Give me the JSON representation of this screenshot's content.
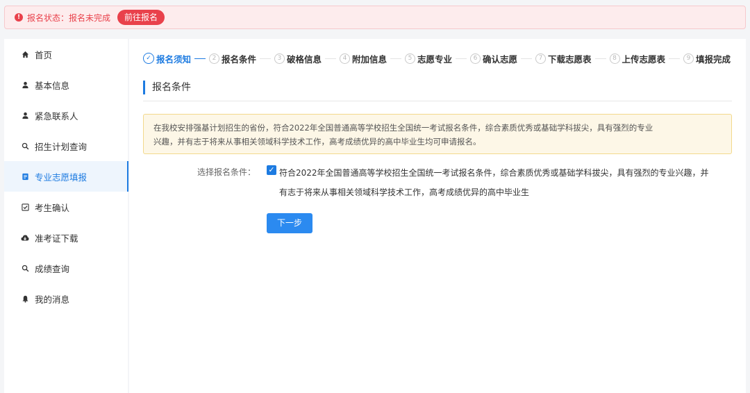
{
  "alert": {
    "status_text": "报名状态：报名未完成",
    "action_label": "前往报名"
  },
  "sidebar": {
    "items": [
      {
        "label": "首页",
        "icon": "home-icon"
      },
      {
        "label": "基本信息",
        "icon": "user-icon"
      },
      {
        "label": "紧急联系人",
        "icon": "user-icon"
      },
      {
        "label": "招生计划查询",
        "icon": "search-icon"
      },
      {
        "label": "专业志愿填报",
        "icon": "document-icon",
        "active": true
      },
      {
        "label": "考生确认",
        "icon": "checkbox-icon"
      },
      {
        "label": "准考证下载",
        "icon": "cloud-download-icon"
      },
      {
        "label": "成绩查询",
        "icon": "search-icon"
      },
      {
        "label": "我的消息",
        "icon": "bell-icon"
      }
    ]
  },
  "steps": [
    {
      "num": "✓",
      "label": "报名须知",
      "done": true
    },
    {
      "num": "2",
      "label": "报名条件"
    },
    {
      "num": "3",
      "label": "破格信息"
    },
    {
      "num": "4",
      "label": "附加信息"
    },
    {
      "num": "5",
      "label": "志愿专业"
    },
    {
      "num": "6",
      "label": "确认志愿"
    },
    {
      "num": "7",
      "label": "下载志愿表"
    },
    {
      "num": "8",
      "label": "上传志愿表"
    },
    {
      "num": "9",
      "label": "填报完成"
    }
  ],
  "main": {
    "section_title": "报名条件",
    "notice_line1": "在我校安排强基计划招生的省份，符合2022年全国普通高等学校招生全国统一考试报名条件，综合素质优秀或基础学科拔尖，具有强烈的专业",
    "notice_line2": "兴趣，并有志于将来从事相关领域科学技术工作，高考成绩优异的高中毕业生均可申请报名。",
    "condition_label": "选择报名条件：",
    "condition_checked": true,
    "condition_line1": "符合2022年全国普通高等学校招生全国统一考试报名条件，综合素质优秀或基础学科拔尖，具有强烈的专业兴趣，并",
    "condition_line2": "有志于将来从事相关领域科学技术工作，高考成绩优异的高中毕业生",
    "next_label": "下一步"
  },
  "colors": {
    "accent": "#1d7be1",
    "alert": "#e9414b",
    "notice_bg": "#fdf7e7"
  }
}
